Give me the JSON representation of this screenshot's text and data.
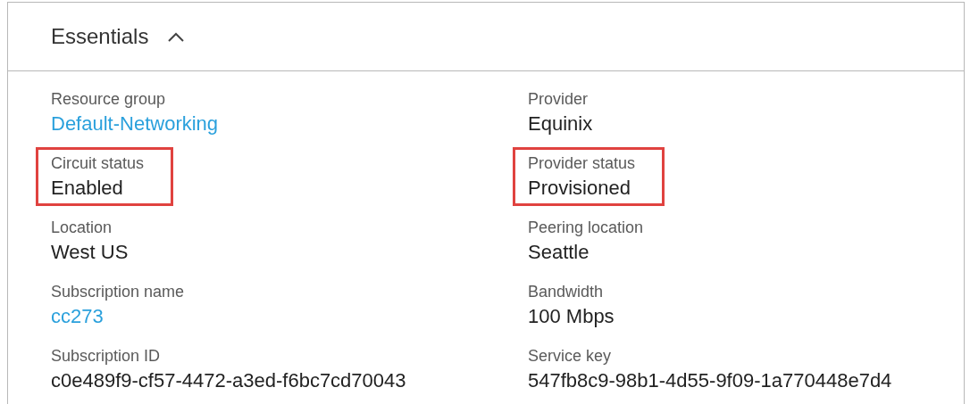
{
  "panel": {
    "title": "Essentials",
    "expanded": true
  },
  "columns": [
    {
      "fields": [
        {
          "label": "Resource group",
          "value": "Default-Networking",
          "kind": "link",
          "highlighted": false
        },
        {
          "label": "Circuit status",
          "value": "Enabled",
          "kind": "text",
          "highlighted": true
        },
        {
          "label": "Location",
          "value": "West US",
          "kind": "text",
          "highlighted": false
        },
        {
          "label": "Subscription name",
          "value": "cc273",
          "kind": "link",
          "highlighted": false
        },
        {
          "label": "Subscription ID",
          "value": "c0e489f9-cf57-4472-a3ed-f6bc7cd70043",
          "kind": "text",
          "highlighted": false
        }
      ]
    },
    {
      "fields": [
        {
          "label": "Provider",
          "value": "Equinix",
          "kind": "text",
          "highlighted": false
        },
        {
          "label": "Provider status",
          "value": "Provisioned",
          "kind": "text",
          "highlighted": true
        },
        {
          "label": "Peering location",
          "value": "Seattle",
          "kind": "text",
          "highlighted": false
        },
        {
          "label": "Bandwidth",
          "value": "100 Mbps",
          "kind": "text",
          "highlighted": false
        },
        {
          "label": "Service key",
          "value": "547fb8c9-98b1-4d55-9f09-1a770448e7d4",
          "kind": "text",
          "highlighted": false
        }
      ]
    }
  ]
}
